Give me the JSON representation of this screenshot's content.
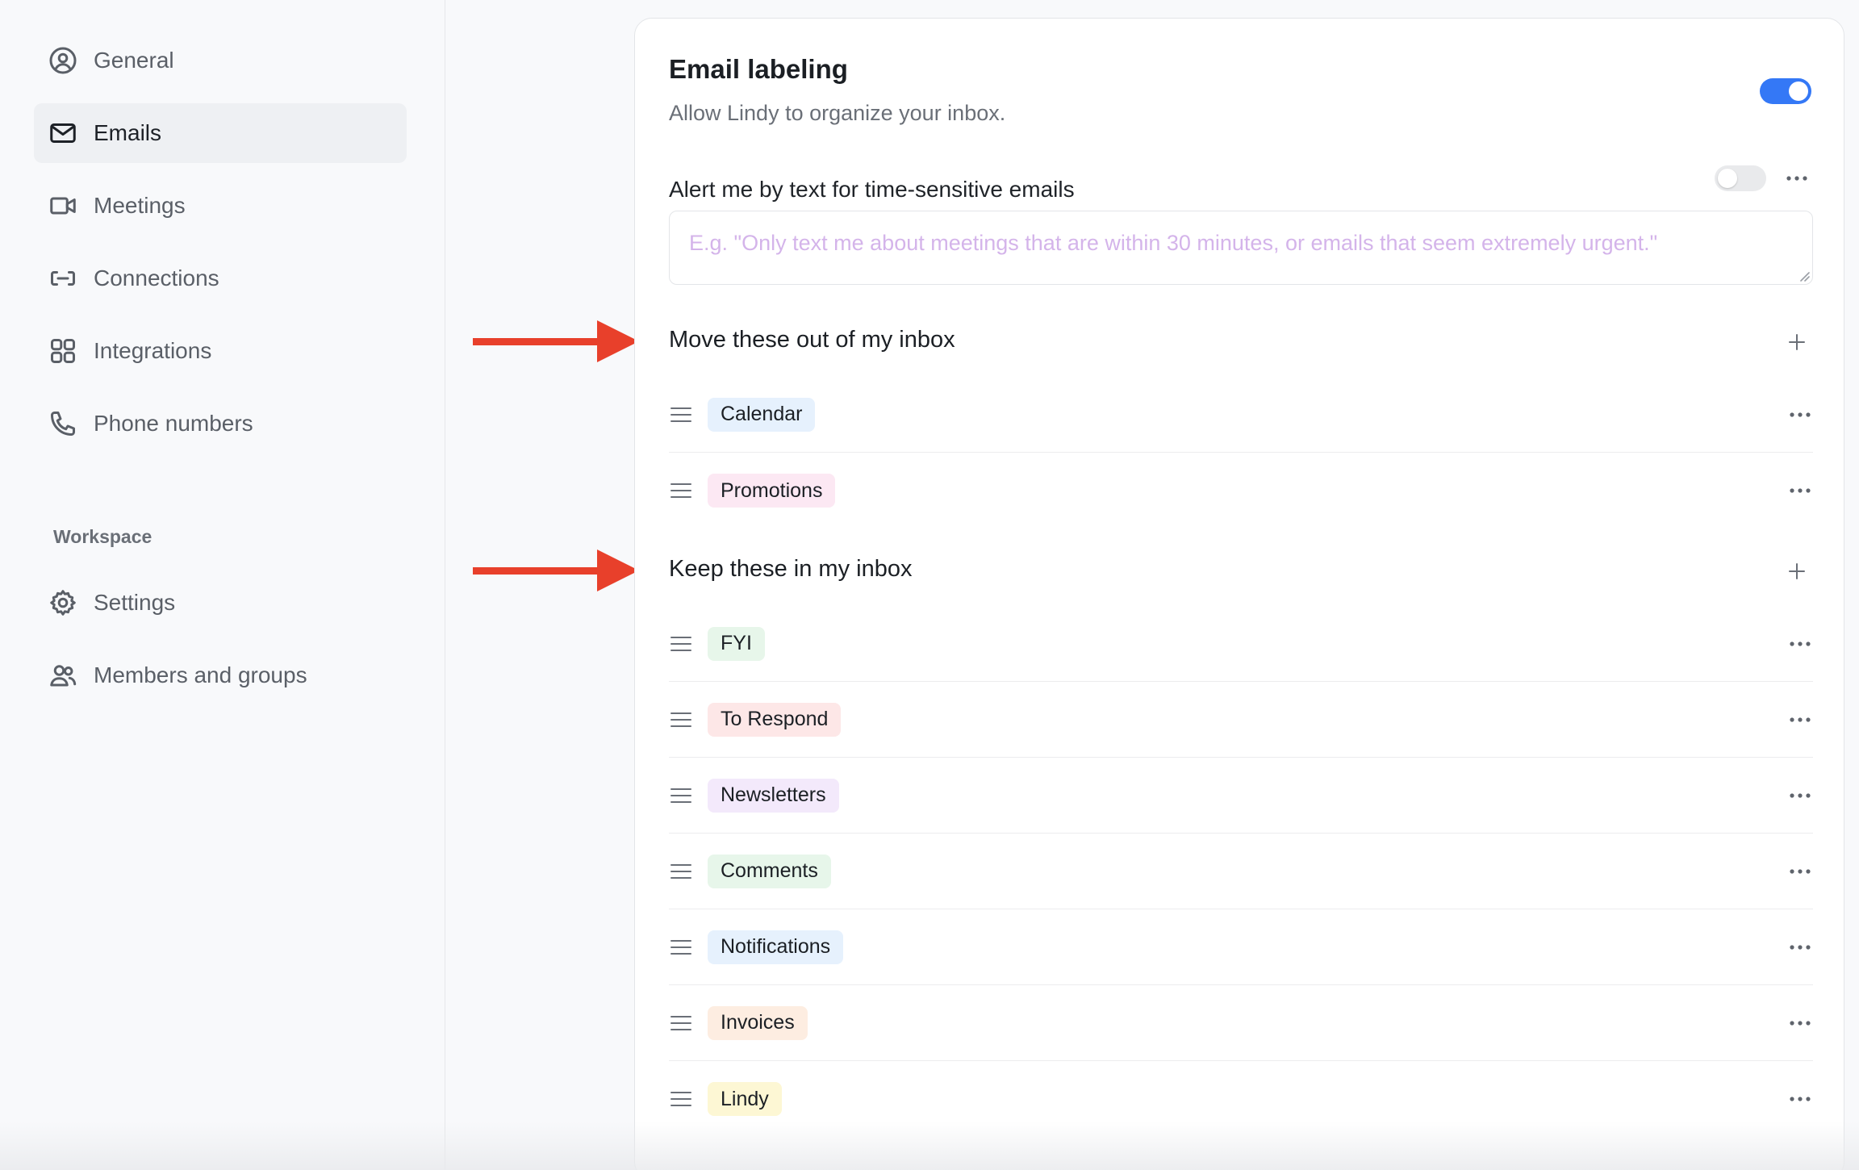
{
  "sidebar": {
    "items": [
      {
        "label": "General",
        "icon": "user-circle-icon",
        "active": false
      },
      {
        "label": "Emails",
        "icon": "mail-icon",
        "active": true
      },
      {
        "label": "Meetings",
        "icon": "video-icon",
        "active": false
      },
      {
        "label": "Connections",
        "icon": "link-icon",
        "active": false
      },
      {
        "label": "Integrations",
        "icon": "grid-icon",
        "active": false
      },
      {
        "label": "Phone numbers",
        "icon": "phone-icon",
        "active": false
      }
    ],
    "workspace_label": "Workspace",
    "workspace_items": [
      {
        "label": "Settings",
        "icon": "gear-icon"
      },
      {
        "label": "Members and groups",
        "icon": "users-icon"
      }
    ]
  },
  "card": {
    "title": "Email labeling",
    "subtitle": "Allow Lindy to organize your inbox.",
    "labeling_enabled": true,
    "alert_label": "Alert me by text for time-sensitive emails",
    "alert_enabled": false,
    "alert_placeholder": "E.g. \"Only text me about meetings that are within 30 minutes, or emails that seem extremely urgent.\"",
    "move_out": {
      "heading": "Move these out of my inbox",
      "labels": [
        {
          "name": "Calendar",
          "color": "#e6f1fd"
        },
        {
          "name": "Promotions",
          "color": "#fce8f3"
        }
      ]
    },
    "keep_in": {
      "heading": "Keep these in my inbox",
      "labels": [
        {
          "name": "FYI",
          "color": "#e7f6ea"
        },
        {
          "name": "To Respond",
          "color": "#fde7e7"
        },
        {
          "name": "Newsletters",
          "color": "#f3e9fb"
        },
        {
          "name": "Comments",
          "color": "#e7f6ea"
        },
        {
          "name": "Notifications",
          "color": "#e6f1fd"
        },
        {
          "name": "Invoices",
          "color": "#fdede1"
        },
        {
          "name": "Lindy",
          "color": "#fdf7d4"
        }
      ]
    }
  },
  "colors": {
    "accent": "#3478f6",
    "arrow": "#e8402b"
  }
}
